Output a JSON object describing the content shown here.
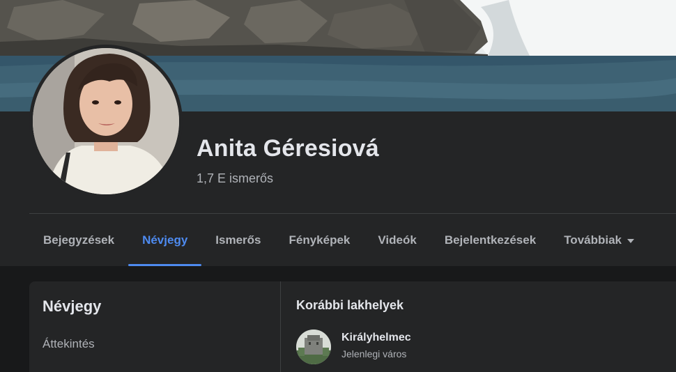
{
  "profile": {
    "name": "Anita Géresiová",
    "friends": "1,7 E ismerős"
  },
  "tabs": [
    {
      "label": "Bejegyzések",
      "active": false
    },
    {
      "label": "Névjegy",
      "active": true
    },
    {
      "label": "Ismerős",
      "active": false
    },
    {
      "label": "Fényképek",
      "active": false
    },
    {
      "label": "Videók",
      "active": false
    },
    {
      "label": "Bejelentkezések",
      "active": false
    },
    {
      "label": "Továbbiak",
      "active": false,
      "dropdown": true
    }
  ],
  "about": {
    "title": "Névjegy",
    "items": [
      "Áttekintés"
    ]
  },
  "places": {
    "title": "Korábbi lakhelyek",
    "entries": [
      {
        "name": "Királyhelmec",
        "desc": "Jelenlegi város"
      }
    ]
  },
  "colors": {
    "background": "#18191a",
    "surface": "#242526",
    "accent": "#4e8bf0",
    "text_primary": "#e4e6eb",
    "text_secondary": "#b0b3b8"
  }
}
